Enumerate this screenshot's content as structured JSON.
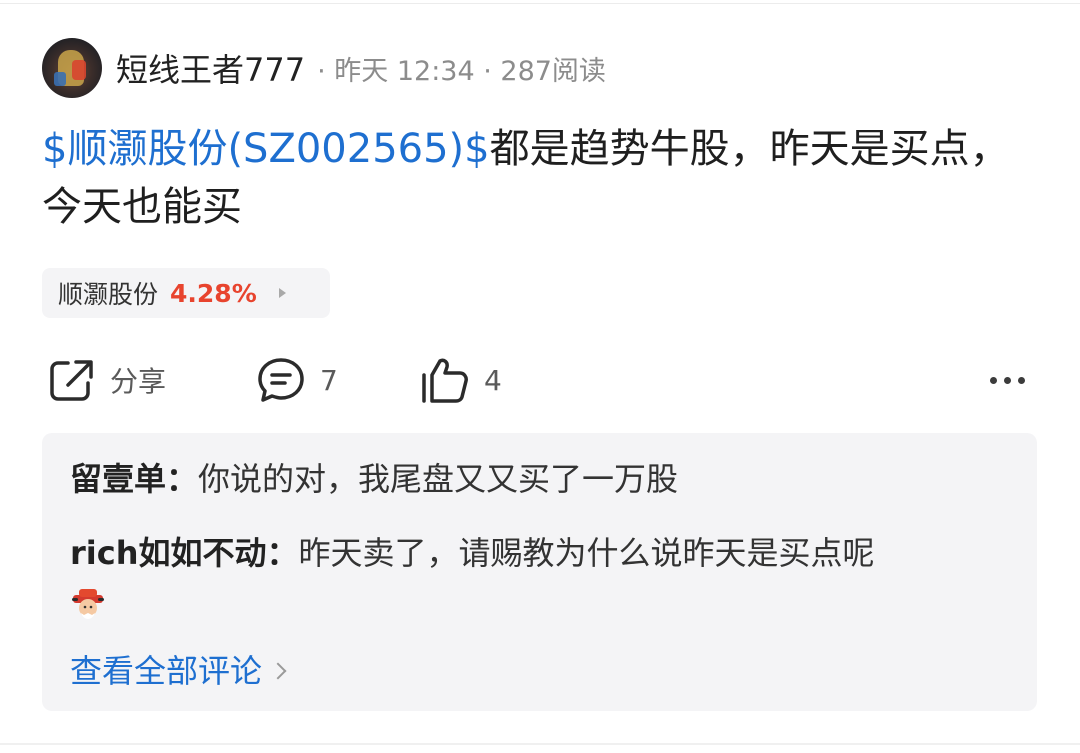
{
  "post": {
    "author": "短线王者777",
    "meta": "· 昨天 12:34 · 287阅读",
    "stock_link": "$顺灏股份(SZ002565)$",
    "body": "都是趋势牛股，昨天是买点，今天也能买"
  },
  "stock_chip": {
    "name": "顺灏股份",
    "change": "4.28%"
  },
  "actions": {
    "share_label": "分享",
    "comment_count": "7",
    "like_count": "4"
  },
  "comments": [
    {
      "author": "留壹单：",
      "text": "你说的对，我尾盘又又买了一万股"
    },
    {
      "author": "rich如如不动：",
      "text": "昨天卖了，请赐教为什么说昨天是买点呢"
    }
  ],
  "view_all_label": "查看全部评论",
  "colors": {
    "link": "#1e6fd0",
    "up": "#e8442e",
    "panel_bg": "#f4f4f6"
  },
  "icons": [
    "share-icon",
    "comment-icon",
    "like-icon",
    "more-icon",
    "chevron-right-icon",
    "emoji-icon"
  ]
}
